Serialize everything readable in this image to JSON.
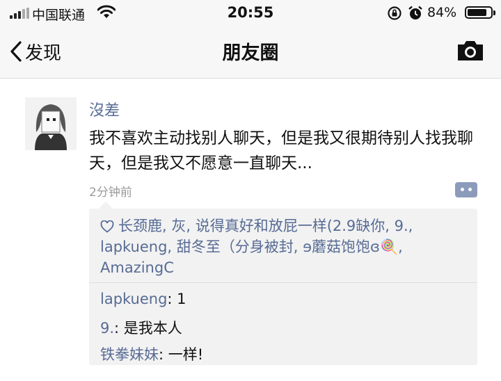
{
  "status_bar": {
    "carrier": "中国联通",
    "time": "20:55",
    "battery_percent": "84%",
    "battery_level": 0.84
  },
  "nav": {
    "back_label": "发现",
    "title": "朋友圈"
  },
  "post": {
    "author": "沒差",
    "content": "我不喜欢主动找别人聊天，但是我又很期待别人找我聊天，但是我又不愿意一直聊天...",
    "time_ago": "2分钟前",
    "likes_text": "长颈鹿, 灰, 说得真好和放屁一样(2.9缺你, 9., lapkueng, 甜冬至（分身被封, ɘ蘑菇饱饱ɞ🍭, AmazingC",
    "comments": [
      {
        "name": "lapkueng",
        "text": ": 1"
      },
      {
        "name": "9.",
        "text": ": 是我本人"
      },
      {
        "name": "铁拳妹妹",
        "text": ": 一样!"
      }
    ]
  },
  "colors": {
    "link": "#576b95",
    "panel_bg": "#f2f2f2",
    "bar_bg": "#f7f7f7"
  },
  "icons": [
    "signal-icon",
    "wifi-icon",
    "rotation-lock-icon",
    "alarm-icon",
    "battery-icon",
    "back-chevron-icon",
    "camera-icon",
    "more-actions-icon",
    "heart-icon"
  ]
}
